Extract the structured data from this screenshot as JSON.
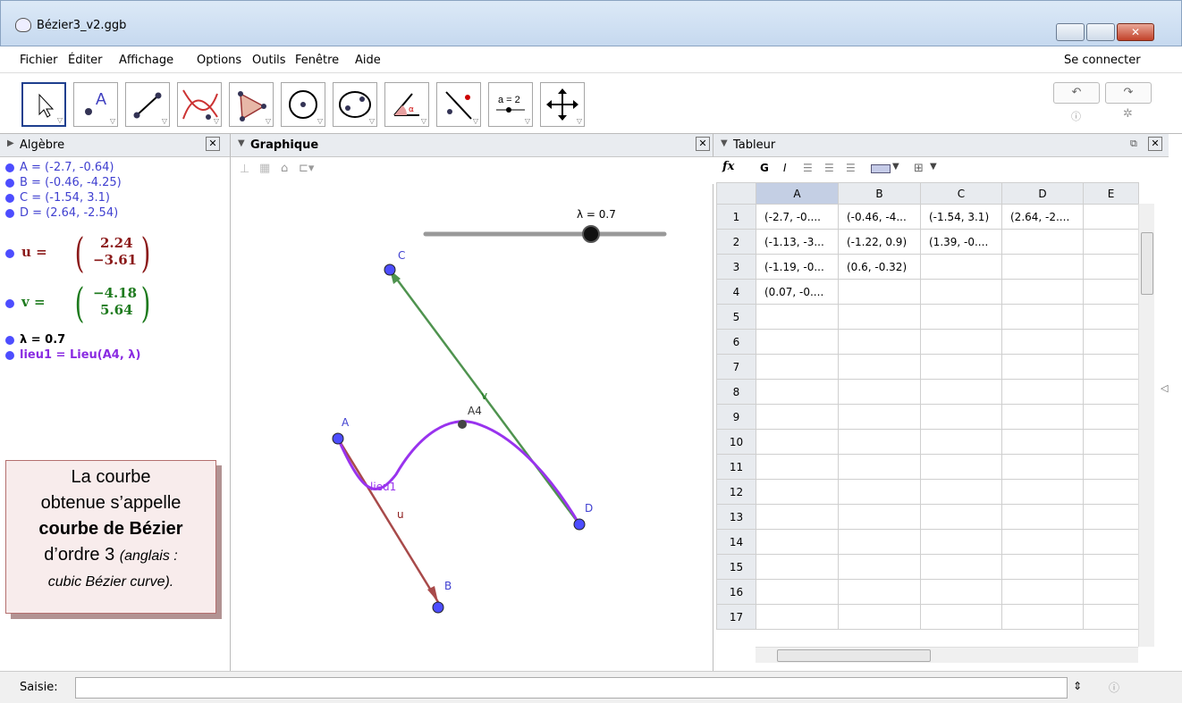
{
  "window": {
    "title": "Bézier3_v2.ggb"
  },
  "menu": {
    "items": [
      "Fichier",
      "Éditer",
      "Affichage",
      "Options",
      "Outils",
      "Fenêtre",
      "Aide"
    ],
    "login": "Se connecter"
  },
  "toolbar": {
    "undo_icon": "undo-icon",
    "redo_icon": "redo-icon",
    "help_icon": "help-icon",
    "settings_icon": "gear-icon"
  },
  "algebra": {
    "title": "Algèbre",
    "items": [
      {
        "text": "A = (-2.7, -0.64)",
        "color": "#4d4dff"
      },
      {
        "text": "B = (-0.46, -4.25)",
        "color": "#4d4dff"
      },
      {
        "text": "C = (-1.54, 3.1)",
        "color": "#4d4dff"
      },
      {
        "text": "D = (2.64, -2.54)",
        "color": "#4d4dff"
      }
    ],
    "u": {
      "name": "u =",
      "x": "2.24",
      "y": "−3.61",
      "color": "#8b1a1a"
    },
    "v": {
      "name": "v =",
      "x": "−4.18",
      "y": "5.64",
      "color": "#1e7a1e"
    },
    "lambda": "λ = 0.7",
    "lieu": "lieu1 = Lieu(A4, λ)"
  },
  "graphics": {
    "title": "Graphique",
    "slider_label": "λ = 0.7",
    "slider_value": 0.7,
    "labels": {
      "A": "A",
      "B": "B",
      "C": "C",
      "D": "D",
      "A4": "A4",
      "u": "u",
      "v": "v",
      "lieu": "lieu1"
    }
  },
  "spreadsheet": {
    "title": "Tableur",
    "fx": "fx",
    "bold": "G",
    "italic": "I",
    "columns": [
      "A",
      "B",
      "C",
      "D",
      "E"
    ],
    "rows": [
      [
        "(-2.7, -0....",
        "(-0.46, -4...",
        "(-1.54, 3.1)",
        "(2.64, -2....",
        ""
      ],
      [
        "(-1.13, -3...",
        "(-1.22, 0.9)",
        "(1.39, -0....",
        "",
        ""
      ],
      [
        "(-1.19, -0...",
        "(0.6, -0.32)",
        "",
        "",
        ""
      ],
      [
        "(0.07, -0....",
        "",
        "",
        "",
        ""
      ],
      [
        "",
        "",
        "",
        "",
        ""
      ],
      [
        "",
        "",
        "",
        "",
        ""
      ],
      [
        "",
        "",
        "",
        "",
        ""
      ],
      [
        "",
        "",
        "",
        "",
        ""
      ],
      [
        "",
        "",
        "",
        "",
        ""
      ],
      [
        "",
        "",
        "",
        "",
        ""
      ],
      [
        "",
        "",
        "",
        "",
        ""
      ],
      [
        "",
        "",
        "",
        "",
        ""
      ],
      [
        "",
        "",
        "",
        "",
        ""
      ],
      [
        "",
        "",
        "",
        "",
        ""
      ],
      [
        "",
        "",
        "",
        "",
        ""
      ],
      [
        "",
        "",
        "",
        "",
        ""
      ],
      [
        "",
        "",
        "",
        "",
        ""
      ]
    ]
  },
  "input": {
    "label": "Saisie:",
    "value": ""
  },
  "callout": {
    "line1": "La courbe",
    "line2": "obtenue s’appelle",
    "bold": "courbe de Bézier",
    "line4a": "d’ordre 3 ",
    "line4b": "(anglais :",
    "line5": "cubic Bézier curve)."
  }
}
